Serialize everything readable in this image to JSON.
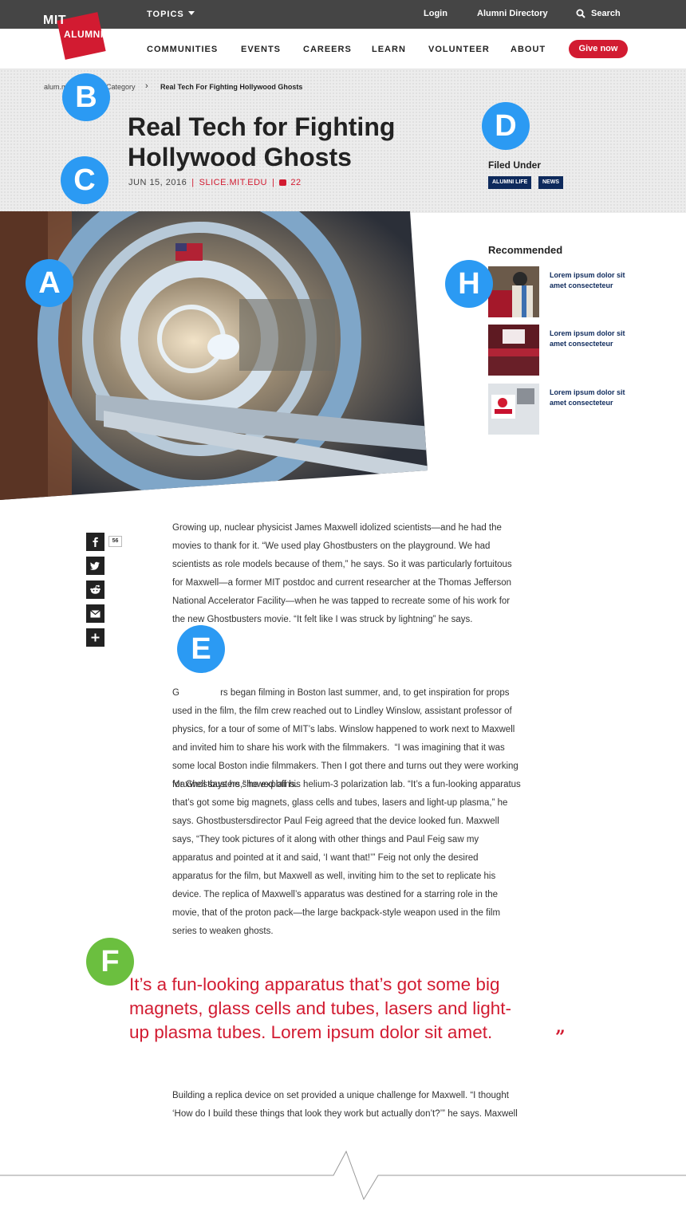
{
  "header": {
    "logo_mit": "MIT",
    "logo_alumni": "ALUMNI",
    "topics_label": "TOPICS",
    "login": "Login",
    "alumni_directory": "Alumni Directory",
    "search": "Search"
  },
  "nav": {
    "items": [
      "COMMUNITIES",
      "EVENTS",
      "CAREERS",
      "LEARN",
      "VOLUNTEER",
      "ABOUT"
    ],
    "give_now": "Give now"
  },
  "breadcrumb": {
    "home": "alum.m",
    "category": "Category",
    "current": "Real Tech For Fighting Hollywood Ghosts"
  },
  "article": {
    "title": "Real Tech for Fighting Hollywood Ghosts",
    "date": "JUN 15, 2016",
    "source": "SLICE.MIT.EDU",
    "comment_count": "22"
  },
  "filed_under": {
    "label": "Filed Under",
    "tags": [
      "ALUMNI LIFE",
      "NEWS"
    ]
  },
  "recommended": {
    "title": "Recommended",
    "items": [
      {
        "text": "Lorem ipsum dolor sit amet consecteteur"
      },
      {
        "text": "Lorem ipsum dolor sit amet consecteteur"
      },
      {
        "text": "Lorem ipsum dolor sit amet consecteteur"
      }
    ]
  },
  "share": {
    "facebook_count": "56",
    "icons": [
      "facebook-icon",
      "twitter-icon",
      "reddit-icon",
      "email-icon",
      "plus-icon"
    ]
  },
  "markers": {
    "a": "A",
    "b": "B",
    "c": "C",
    "d": "D",
    "e": "E",
    "f": "F",
    "h": "H"
  },
  "body": {
    "p1_lines": [
      "Growing up, nuclear physicist James Maxwell idolized scientists—and he had the",
      "movies to thank for it. “We used play Ghostbusters on the playground. We had",
      "scientists as role models because of them,” he says. So it was particularly fortuitous",
      "for Maxwell—a former MIT postdoc and current researcher at the Thomas Jefferson",
      "National Accelerator Facility—when he was tapped to recreate some of his work for",
      "the new Ghostbusters movie. “It felt like I was struck by lightning” he says."
    ],
    "p2_lines": [
      "G                rs began filming in Boston last summer, and, to get inspiration for props",
      "used in the film, the film crew reached out to Lindley Winslow, assistant professor of",
      "physics, for a tour of some of MIT’s labs. Winslow happened to work next to Maxwell",
      "and invited him to share his work with the filmmakers.  “I was imagining that it was",
      "some local Boston indie filmmakers. Then I got there and turns out they were working",
      "for Ghostbusters,” he explains."
    ],
    "p3_lines": [
      "Maxwell says he showed off his helium-3 polarization lab. “It’s a fun-looking apparatus",
      "that’s got some big magnets, glass cells and tubes, lasers and light-up plasma,” he",
      "says. Ghostbustersdirector Paul Feig agreed that the device looked fun. Maxwell",
      "says, “They took pictures of it along with other things and Paul Feig saw my",
      "apparatus and pointed at it and said, ‘I want that!’” Feig not only the desired",
      "apparatus for the film, but Maxwell as well, inviting him to the set to replicate his",
      "device. The replica of Maxwell’s apparatus was destined for a starring role in the",
      "movie, that of the proton pack—the large backpack-style weapon used in the film",
      "series to weaken ghosts."
    ],
    "quote_lines": [
      "It’s a fun-looking apparatus that’s got some big",
      "magnets, glass cells and tubes, lasers and light-",
      "up plasma tubes.  Lorem ipsum dolor sit amet."
    ],
    "p4_lines": [
      "Building a replica device on set provided a unique challenge for Maxwell. “I thought",
      "‘How do I build these things that look they work but actually don’t?’” he says. Maxwell"
    ]
  },
  "colors": {
    "topbar": "#454545",
    "accent_red": "#d21b31",
    "tag_navy": "#0e2a5c",
    "marker_blue": "#2b9af3",
    "marker_green": "#6bbf3f"
  }
}
